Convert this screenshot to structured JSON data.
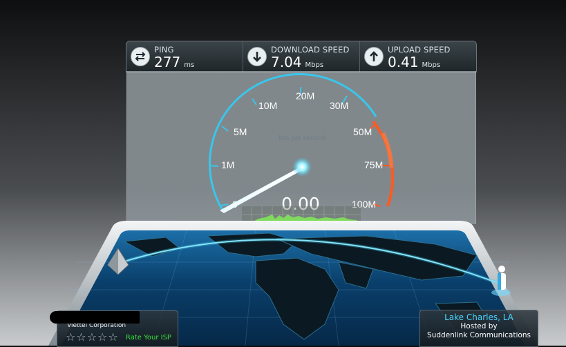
{
  "stats": {
    "ping": {
      "label": "PING",
      "value": "277",
      "unit": "ms"
    },
    "download": {
      "label": "DOWNLOAD SPEED",
      "value": "7.04",
      "unit": "Mbps"
    },
    "upload": {
      "label": "UPLOAD SPEED",
      "value": "0.41",
      "unit": "Mbps"
    }
  },
  "gauge": {
    "caption": "bits per second",
    "readout": "0.00",
    "ticks": [
      "0",
      "1M",
      "5M",
      "10M",
      "20M",
      "30M",
      "50M",
      "75M",
      "100M"
    ]
  },
  "isp": {
    "name": "Viettel Corporation",
    "stars": "☆☆☆☆☆",
    "rate_label": "Rate Your ISP"
  },
  "server": {
    "location": "Lake Charles, LA",
    "hosted_by": "Hosted by",
    "provider": "Suddenlink Communications"
  },
  "colors": {
    "accent": "#39c6ec",
    "warning": "#ff5a1f",
    "rating": "#39e03f"
  }
}
